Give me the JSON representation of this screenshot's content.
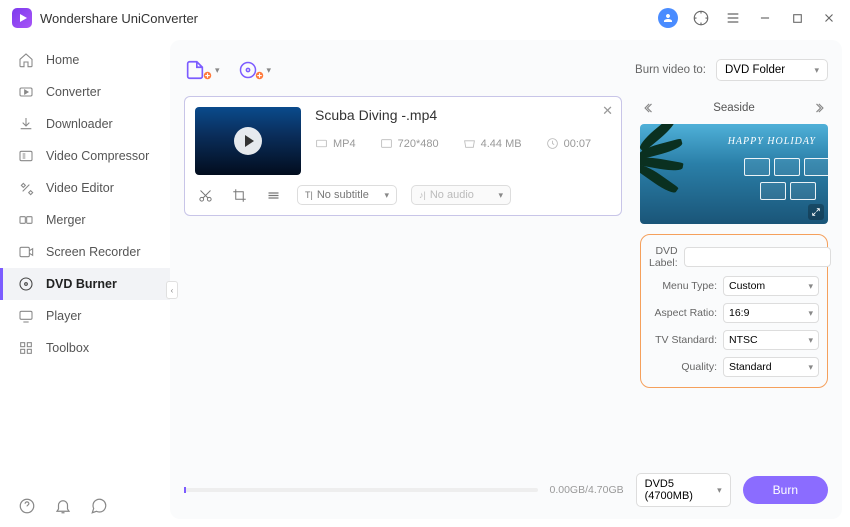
{
  "app_title": "Wondershare UniConverter",
  "sidebar": {
    "items": [
      {
        "label": "Home"
      },
      {
        "label": "Converter"
      },
      {
        "label": "Downloader"
      },
      {
        "label": "Video Compressor"
      },
      {
        "label": "Video Editor"
      },
      {
        "label": "Merger"
      },
      {
        "label": "Screen Recorder"
      },
      {
        "label": "DVD Burner"
      },
      {
        "label": "Player"
      },
      {
        "label": "Toolbox"
      }
    ]
  },
  "toolbar": {
    "burn_to_label": "Burn video to:",
    "burn_target": "DVD Folder"
  },
  "video": {
    "title": "Scuba Diving -.mp4",
    "format": "MP4",
    "resolution": "720*480",
    "size": "4.44 MB",
    "duration": "00:07",
    "subtitle": "No subtitle",
    "audio": "No audio"
  },
  "menu": {
    "name": "Seaside",
    "preview_text": "HAPPY HOLIDAY"
  },
  "settings": {
    "dvd_label_label": "DVD Label:",
    "dvd_label_value": "",
    "menu_type_label": "Menu Type:",
    "menu_type_value": "Custom",
    "aspect_ratio_label": "Aspect Ratio:",
    "aspect_ratio_value": "16:9",
    "tv_standard_label": "TV Standard:",
    "tv_standard_value": "NTSC",
    "quality_label": "Quality:",
    "quality_value": "Standard"
  },
  "bottom": {
    "size": "0.00GB/4.70GB",
    "disc": "DVD5 (4700MB)",
    "burn_label": "Burn"
  }
}
